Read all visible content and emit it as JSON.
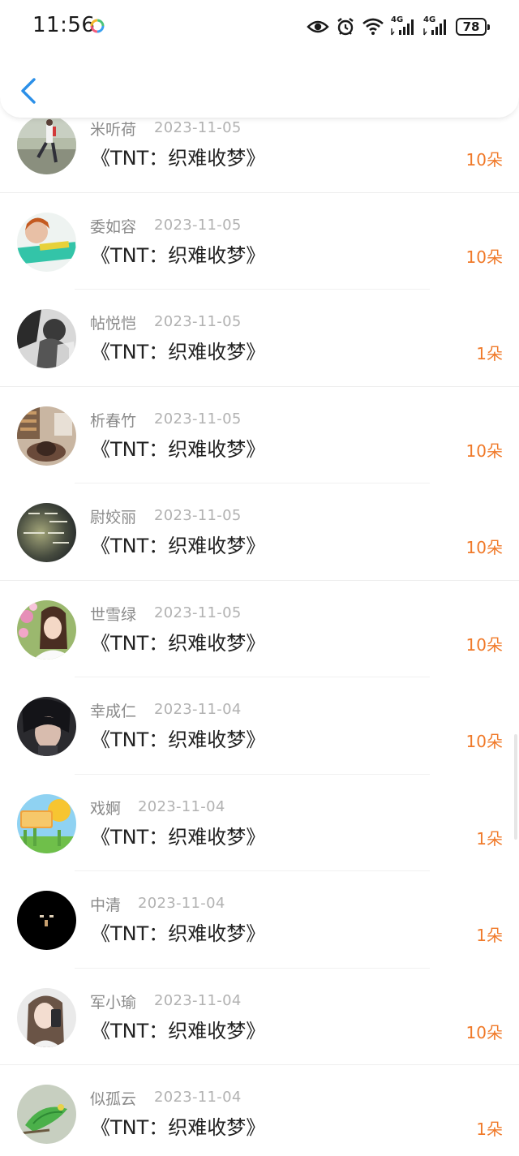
{
  "status_bar": {
    "time": "11:56",
    "battery": "78",
    "network_label_1": "4G",
    "network_label_2": "4G"
  },
  "header": {
    "back_icon": "chevron-left-icon"
  },
  "colors": {
    "accent_back": "#2b8fe8",
    "count_orange": "#f07a2a",
    "name_gray": "#8a8a8a",
    "date_gray": "#b2b2b2"
  },
  "list": [
    {
      "name": "米听荷",
      "date": "2023-11-05",
      "title": "《TNT：织难收梦》",
      "count": "10朵"
    },
    {
      "name": "委如容",
      "date": "2023-11-05",
      "title": "《TNT：织难收梦》",
      "count": "10朵"
    },
    {
      "name": "帖悦恺",
      "date": "2023-11-05",
      "title": "《TNT：织难收梦》",
      "count": "1朵"
    },
    {
      "name": "析春竹",
      "date": "2023-11-05",
      "title": "《TNT：织难收梦》",
      "count": "10朵"
    },
    {
      "name": "尉姣丽",
      "date": "2023-11-05",
      "title": "《TNT：织难收梦》",
      "count": "10朵"
    },
    {
      "name": "世雪绿",
      "date": "2023-11-05",
      "title": "《TNT：织难收梦》",
      "count": "10朵"
    },
    {
      "name": "幸成仁",
      "date": "2023-11-04",
      "title": "《TNT：织难收梦》",
      "count": "10朵"
    },
    {
      "name": "戏婀",
      "date": "2023-11-04",
      "title": "《TNT：织难收梦》",
      "count": "1朵"
    },
    {
      "name": "中清",
      "date": "2023-11-04",
      "title": "《TNT：织难收梦》",
      "count": "1朵"
    },
    {
      "name": "军小瑜",
      "date": "2023-11-04",
      "title": "《TNT：织难收梦》",
      "count": "10朵"
    },
    {
      "name": "似孤云",
      "date": "2023-11-04",
      "title": "《TNT：织难收梦》",
      "count": "1朵"
    }
  ]
}
